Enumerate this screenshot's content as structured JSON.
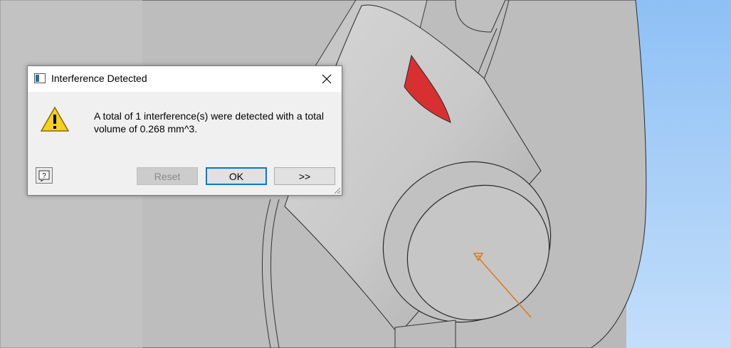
{
  "dialog": {
    "title": "Interference Detected",
    "message": "A total of 1 interference(s) were detected with a total volume of 0.268 mm^3.",
    "buttons": {
      "help_label": "?",
      "reset_label": "Reset",
      "ok_label": "OK",
      "more_label": ">>"
    },
    "reset_enabled": false,
    "default_button": "OK"
  },
  "icons": {
    "close": "close-icon",
    "warning": "warning-icon",
    "help": "help-icon",
    "app": "app-window-icon",
    "resize": "resize-grip-icon"
  },
  "colors": {
    "interference_highlight": "#d83030",
    "sky": "#a9cff7",
    "model_gray": "#c3c3c3",
    "ok_focus": "#0078d7",
    "axis_triad": "#e07a10"
  }
}
